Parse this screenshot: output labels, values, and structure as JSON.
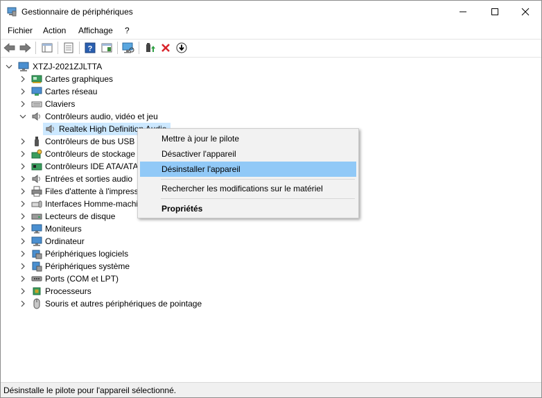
{
  "window": {
    "title": "Gestionnaire de périphériques",
    "controls": {
      "minimize": "minimize-icon",
      "maximize": "maximize-icon",
      "close": "close-icon"
    }
  },
  "menu": [
    "Fichier",
    "Action",
    "Affichage",
    "?"
  ],
  "toolbar": {
    "icons": [
      "back-arrow-icon",
      "forward-arrow-icon",
      "properties-icon",
      "update-driver-icon",
      "help-icon",
      "action-icon",
      "scan-hardware-icon",
      "enable-device-icon",
      "uninstall-device-icon",
      "download-icon"
    ]
  },
  "tree": {
    "root": "XTZJ-2021ZJLTTA",
    "items": [
      {
        "label": "Cartes graphiques",
        "icon": "display-adapter-icon",
        "expanded": false
      },
      {
        "label": "Cartes réseau",
        "icon": "network-adapter-icon",
        "expanded": false
      },
      {
        "label": "Claviers",
        "icon": "keyboard-icon",
        "expanded": false
      },
      {
        "label": "Contrôleurs audio, vidéo et jeu",
        "icon": "speaker-icon",
        "expanded": true,
        "children": [
          {
            "label": "Realtek High Definition Audio",
            "icon": "speaker-icon",
            "selected": true
          }
        ]
      },
      {
        "label": "Contrôleurs de bus USB",
        "icon": "usb-icon",
        "expanded": false
      },
      {
        "label": "Contrôleurs de stockage",
        "icon": "storage-controller-icon",
        "expanded": false
      },
      {
        "label": "Contrôleurs IDE ATA/ATAPI",
        "icon": "ide-controller-icon",
        "expanded": false
      },
      {
        "label": "Entrées et sorties audio",
        "icon": "speaker-icon",
        "expanded": false
      },
      {
        "label": "Files d'attente à l'impression",
        "icon": "printer-icon",
        "expanded": false
      },
      {
        "label": "Interfaces Homme-machine",
        "icon": "hid-icon",
        "expanded": false
      },
      {
        "label": "Lecteurs de disque",
        "icon": "disk-drive-icon",
        "expanded": false
      },
      {
        "label": "Moniteurs",
        "icon": "monitor-icon",
        "expanded": false
      },
      {
        "label": "Ordinateur",
        "icon": "computer-icon",
        "expanded": false
      },
      {
        "label": "Périphériques logiciels",
        "icon": "software-device-icon",
        "expanded": false
      },
      {
        "label": "Périphériques système",
        "icon": "system-device-icon",
        "expanded": false
      },
      {
        "label": "Ports (COM et LPT)",
        "icon": "port-icon",
        "expanded": false
      },
      {
        "label": "Processeurs",
        "icon": "processor-icon",
        "expanded": false
      },
      {
        "label": "Souris et autres périphériques de pointage",
        "icon": "mouse-icon",
        "expanded": false
      }
    ]
  },
  "context_menu": {
    "items": [
      {
        "label": "Mettre à jour le pilote",
        "bold": false,
        "highlighted": false
      },
      {
        "label": "Désactiver l'appareil",
        "bold": false,
        "highlighted": false
      },
      {
        "label": "Désinstaller l'appareil",
        "bold": false,
        "highlighted": true
      },
      {
        "label": "Rechercher les modifications sur le matériel",
        "bold": false,
        "highlighted": false
      },
      {
        "label": "Propriétés",
        "bold": true,
        "highlighted": false
      }
    ]
  },
  "status": "Désinstalle le pilote pour l'appareil sélectionné.",
  "colors": {
    "selection": "#cce8ff",
    "menu_highlight": "#91c9f7",
    "menu_bg": "#f2f2f2",
    "status_bg": "#f0f0f0"
  }
}
